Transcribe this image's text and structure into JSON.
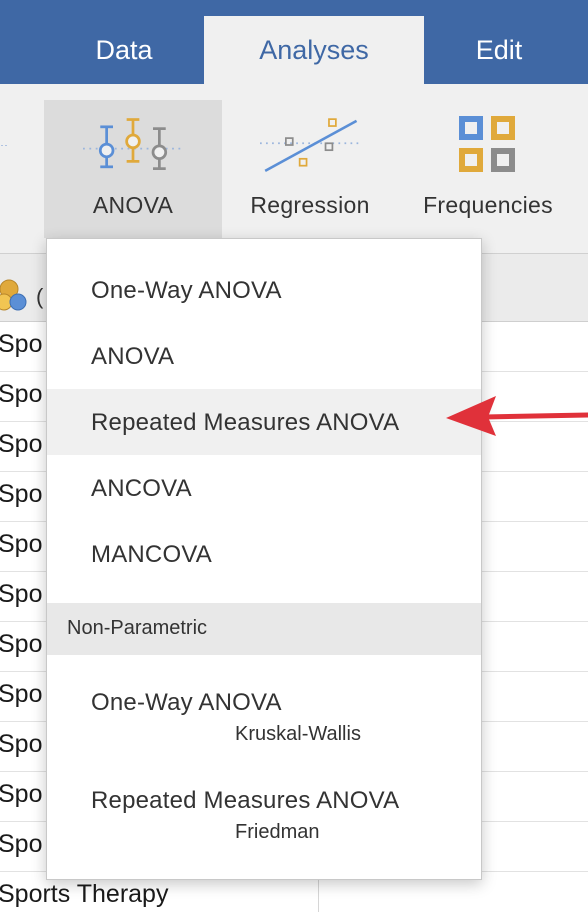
{
  "tabs": {
    "data": "Data",
    "analyses": "Analyses",
    "edit": "Edit",
    "active": "Analyses"
  },
  "ribbon": {
    "anova": {
      "label": "ANOVA",
      "icon": "anova-icon"
    },
    "regression": {
      "label": "Regression",
      "icon": "regression-icon"
    },
    "frequencies": {
      "label": "Frequencies",
      "icon": "frequencies-icon"
    }
  },
  "sheet": {
    "column_header": "(",
    "rows": [
      "Spo",
      "Spo",
      "Spo",
      "Spo",
      "Spo",
      "Spo",
      "Spo",
      "Spo",
      "Spo",
      "Spo",
      "Spo",
      "Sports Therapy"
    ]
  },
  "menu": {
    "items": [
      {
        "label": "One-Way ANOVA"
      },
      {
        "label": "ANOVA"
      },
      {
        "label": "Repeated Measures ANOVA",
        "highlighted": true
      },
      {
        "label": "ANCOVA"
      },
      {
        "label": "MANCOVA"
      }
    ],
    "section_header": "Non-Parametric",
    "nonparametric": [
      {
        "label": "One-Way ANOVA",
        "sublabel": "Kruskal-Wallis"
      },
      {
        "label": "Repeated Measures ANOVA",
        "sublabel": "Friedman"
      }
    ]
  },
  "colors": {
    "tabbar": "#3f68a5",
    "ribbon": "#f0f0f0",
    "arrow": "#e0313a",
    "icon_blue": "#5b8fd6",
    "icon_gold": "#e0a93b",
    "icon_gray": "#8c8c8c"
  }
}
